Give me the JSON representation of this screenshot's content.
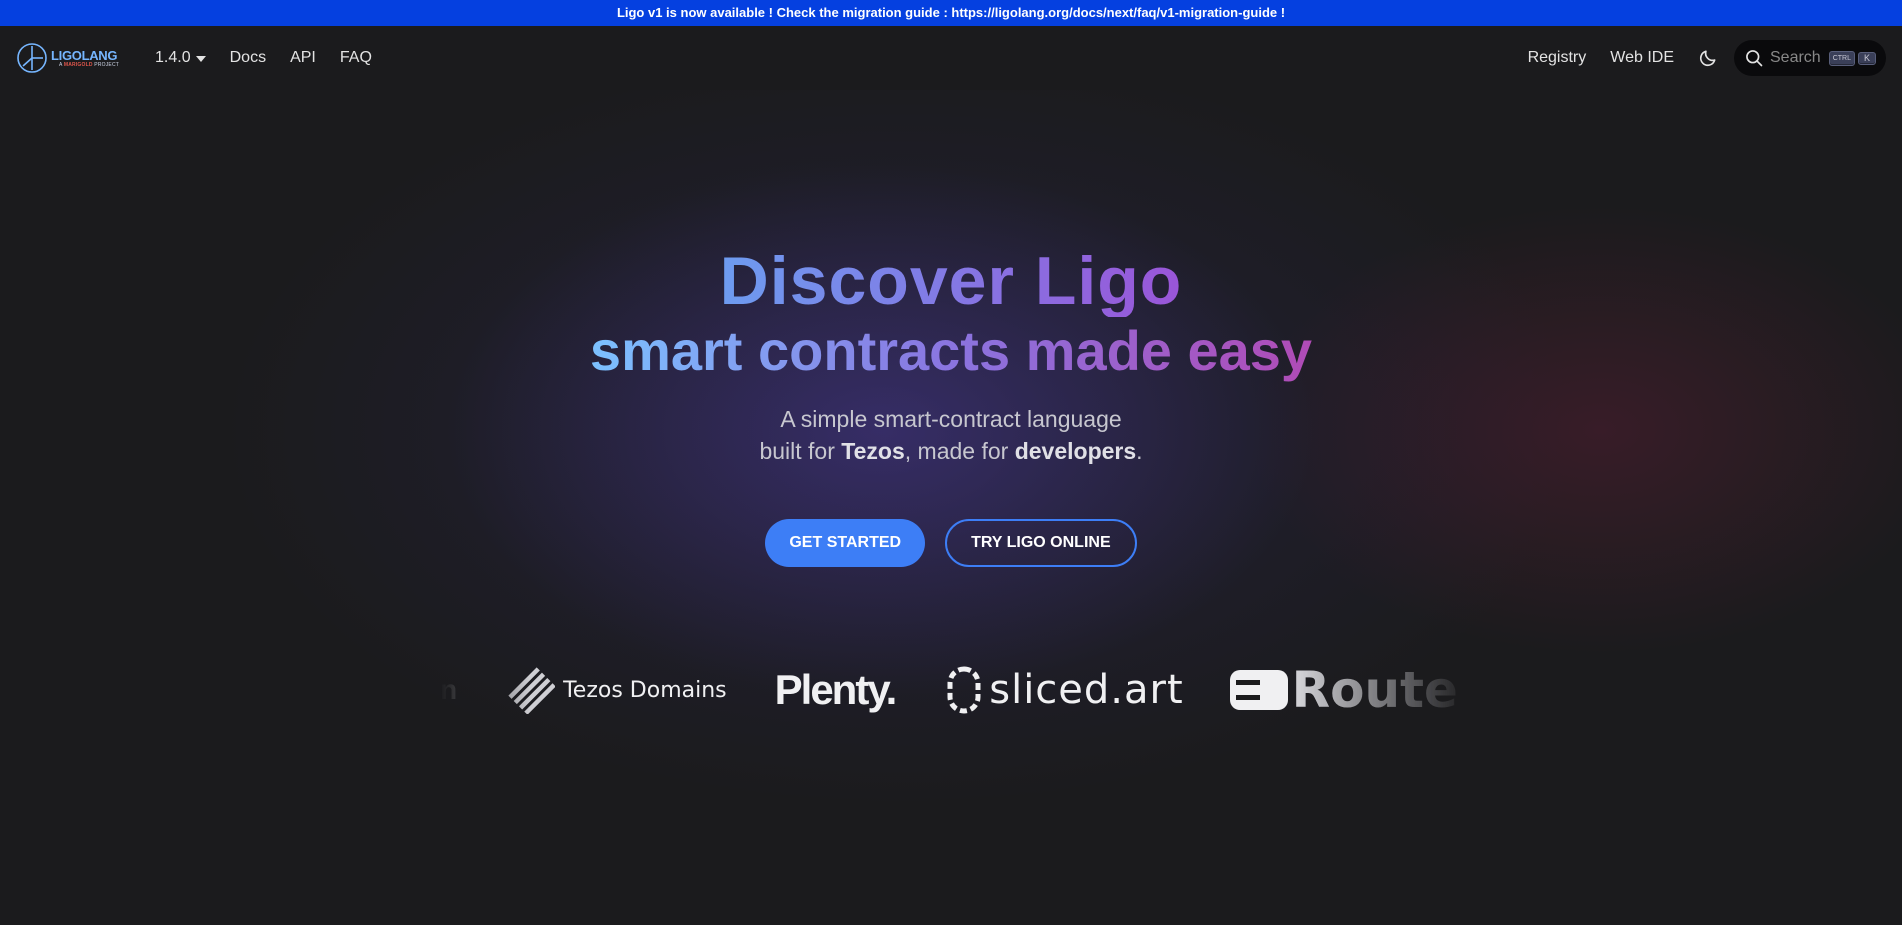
{
  "banner": {
    "text": "Ligo v1 is now available ! Check the migration guide : https://ligolang.org/docs/next/faq/v1-migration-guide !"
  },
  "nav": {
    "logo_main": "LIGOLANG",
    "logo_sub_prefix": "A",
    "logo_sub_brand": "MARIGOLD",
    "logo_sub_suffix": "PROJECT",
    "version": "1.4.0",
    "docs": "Docs",
    "api": "API",
    "faq": "FAQ",
    "registry": "Registry",
    "web_ide": "Web IDE",
    "theme_icon": "moon-icon",
    "search_placeholder": "Search",
    "kbd_ctrl": "CTRL",
    "kbd_k": "K"
  },
  "hero": {
    "title_part1": "Discover ",
    "title_part2": "Ligo",
    "subtitle": "smart contracts made easy",
    "desc_line1": "A simple smart-contract language",
    "desc_line2_prefix": "built for ",
    "desc_line2_tezos": "Tezos",
    "desc_line2_mid": ", made for ",
    "desc_line2_devs": "developers",
    "desc_line2_end": ".",
    "btn_get_started": "GET STARTED",
    "btn_try_online": "TRY LIGO ONLINE"
  },
  "partners": {
    "partial_name": "n",
    "tezos_domains": "Tezos Domains",
    "plenty": "Plenty.",
    "sliced": "sliced.art",
    "route": "Route"
  },
  "colors": {
    "banner_bg": "#0540e0",
    "primary": "#3d7ef6",
    "page_bg": "#1b1b1d"
  }
}
